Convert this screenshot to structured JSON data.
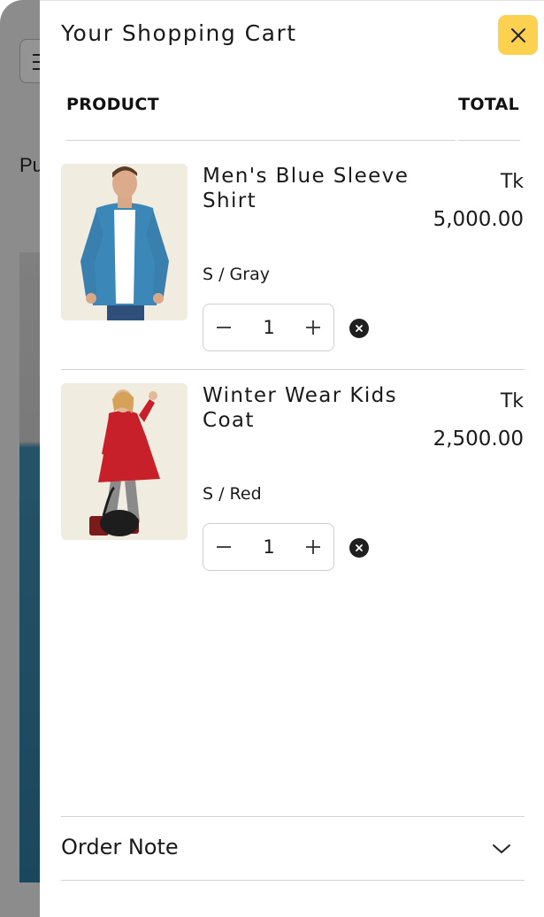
{
  "background": {
    "partial_title": "Pu"
  },
  "cart": {
    "title": "Your Shopping Cart",
    "columns": {
      "product": "PRODUCT",
      "total": "TOTAL"
    },
    "items": [
      {
        "name": "Men's Blue Sleeve Shirt",
        "currency": "Tk",
        "price": "5,000.00",
        "variant": "S / Gray",
        "quantity": "1"
      },
      {
        "name": "Winter Wear Kids Coat",
        "currency": "Tk",
        "price": "2,500.00",
        "variant": "S / Red",
        "quantity": "1"
      }
    ],
    "order_note_label": "Order Note"
  },
  "colors": {
    "close_button": "#fdd150",
    "text": "#1a1a1a",
    "divider": "#d3d3d3"
  },
  "icons": {
    "close": "close-icon",
    "minus": "minus-icon",
    "plus": "plus-icon",
    "remove": "remove-icon",
    "chevron": "chevron-down-icon"
  }
}
